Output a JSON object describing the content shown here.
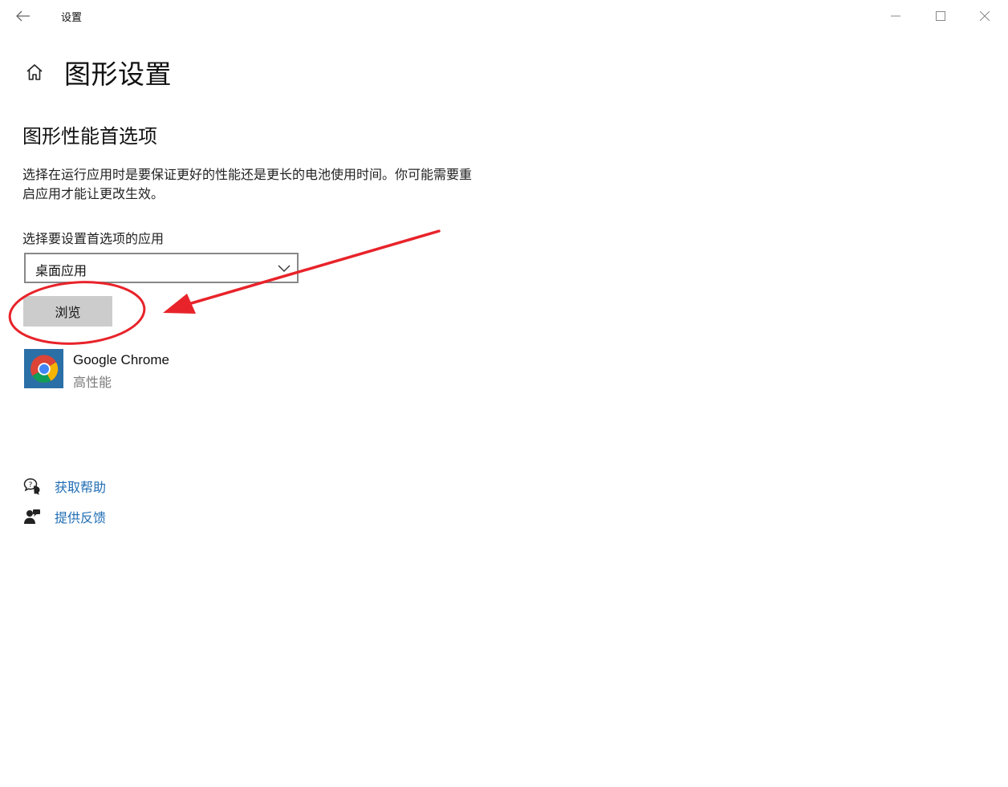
{
  "window": {
    "title": "设置"
  },
  "page": {
    "title": "图形设置",
    "section_title": "图形性能首选项",
    "description": "选择在运行应用时是要保证更好的性能还是更长的电池使用时间。你可能需要重启应用才能让更改生效。"
  },
  "app_selector": {
    "label": "选择要设置首选项的应用",
    "selected": "桌面应用",
    "browse_label": "浏览"
  },
  "apps": [
    {
      "name": "Google Chrome",
      "preference": "高性能",
      "icon": "chrome-icon"
    }
  ],
  "links": {
    "help": "获取帮助",
    "feedback": "提供反馈"
  },
  "icons": {
    "back": "back-arrow-icon",
    "home": "home-icon",
    "minimize": "minimize-icon",
    "maximize": "maximize-icon",
    "close": "close-icon",
    "dropdown": "chevron-down-icon",
    "help": "help-chat-icon",
    "feedback": "feedback-person-icon"
  },
  "colors": {
    "link": "#1f6db4",
    "button_bg": "#cccccc",
    "annotation": "#e8232a",
    "secondary_text": "#7a7a7a"
  }
}
